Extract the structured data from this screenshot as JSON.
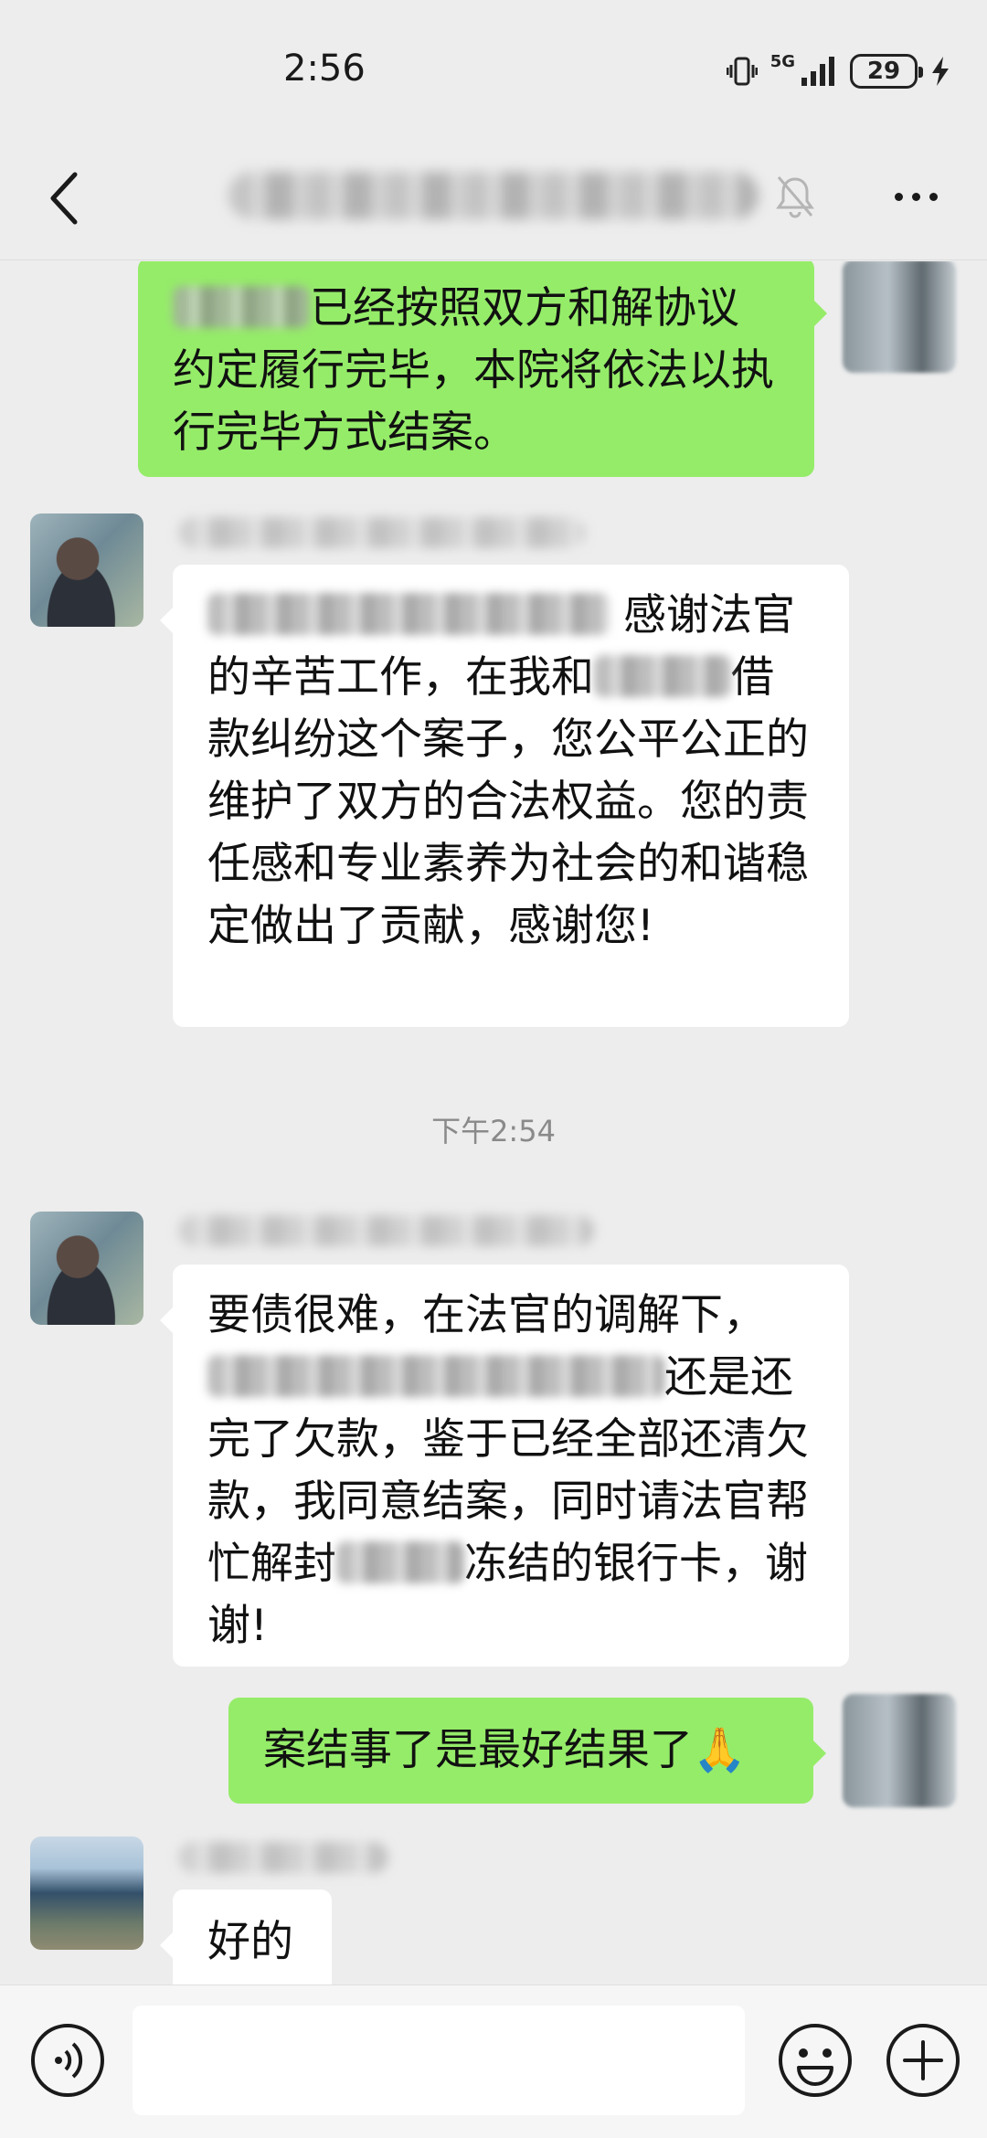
{
  "status_bar": {
    "time": "2:56",
    "network": "5G",
    "battery": "29"
  },
  "title_bar": {
    "title": "",
    "back_icon": "chevron-left-icon",
    "mute_icon": "bell-off-icon",
    "more_icon": "more-horizontal-icon"
  },
  "messages": [
    {
      "side": "out",
      "text": "已经按照双方和解协议约定履行完毕，本院将依法以执行完毕方式结案。"
    },
    {
      "side": "in",
      "sender": "",
      "text_a": "感谢法官的辛苦工作，在我和",
      "text_b": "借款纠纷这个案子，您公平公正的维护了双方的合法权益。您的责任感和专业素养为社会的和谐稳定做出了贡献，感谢您!"
    },
    {
      "type": "time",
      "text": "下午2:54"
    },
    {
      "side": "in",
      "sender": "",
      "text_a": "要债很难，在法官的调解下，",
      "text_b": "还是还完了欠款，鉴于已经全部还清欠款，我同意结案，同时请法官帮忙解封",
      "text_c": "冻结的银行卡，谢谢!"
    },
    {
      "side": "out",
      "text": "案结事了是最好结果了",
      "emoji": "🙏"
    },
    {
      "side": "in",
      "sender": "",
      "text": "好的"
    }
  ],
  "input_bar": {
    "voice_icon": "voice-icon",
    "emoji_icon": "smile-icon",
    "plus_icon": "plus-circle-icon",
    "placeholder": ""
  },
  "colors": {
    "background": "#ededed",
    "outgoing_bubble": "#95ec69",
    "incoming_bubble": "#ffffff"
  }
}
